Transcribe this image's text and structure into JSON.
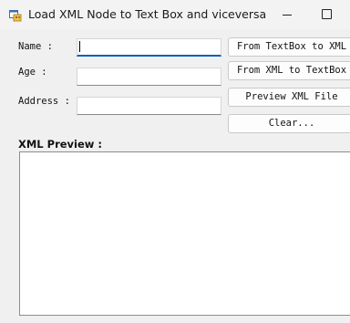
{
  "window": {
    "title": "Load XML Node to Text Box and viceversa",
    "icon": "app-form-icon"
  },
  "form": {
    "name_label": "Name :",
    "age_label": "Age :",
    "address_label": "Address :",
    "name_value": "",
    "age_value": "",
    "address_value": ""
  },
  "buttons": {
    "from_textbox": "From TextBox to XML",
    "from_xml": "From XML to TextBox",
    "preview": "Preview XML File",
    "clear": "Clear..."
  },
  "preview": {
    "label": "XML Preview :",
    "content": ""
  }
}
